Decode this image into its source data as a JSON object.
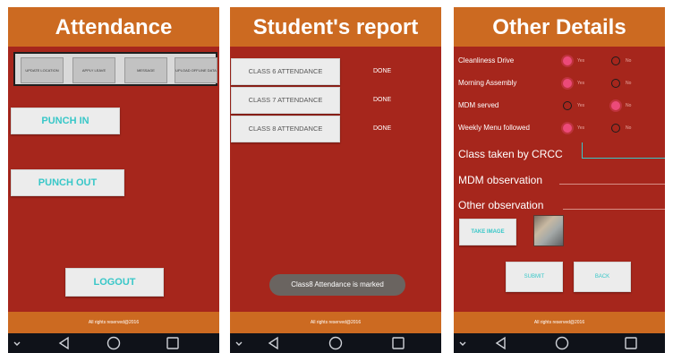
{
  "attendance": {
    "title": "Attendance",
    "toolbar": [
      "UPDATE LOCATION",
      "APPLY LEAVE",
      "MESSAGE",
      "UPLOAD OFFLINE DATA"
    ],
    "punch_in": "PUNCH IN",
    "punch_out": "PUNCH OUT",
    "logout": "LOGOUT",
    "footer": "All rights reserved@2016"
  },
  "report": {
    "title": "Student's report",
    "rows": [
      {
        "label": "CLASS 6 ATTENDANCE",
        "status": "DONE"
      },
      {
        "label": "CLASS 7 ATTENDANCE",
        "status": "DONE"
      },
      {
        "label": "CLASS 8 ATTENDANCE",
        "status": "DONE"
      }
    ],
    "toast": "Class8 Attendance is marked",
    "footer": "All rights reserved@2016"
  },
  "details": {
    "title": "Other Details",
    "questions": [
      {
        "label": "Cleanliness Drive",
        "selected": "Yes"
      },
      {
        "label": "Morning Assembly",
        "selected": "Yes"
      },
      {
        "label": "MDM served",
        "selected": "No"
      },
      {
        "label": "Weekly Menu followed",
        "selected": "Yes"
      }
    ],
    "yes": "Yes",
    "no": "No",
    "class_taken": "Class taken by CRCC",
    "mdm_observation": "MDM observation",
    "other_observation": "Other observation",
    "take_image": "TAKE IMAGE",
    "submit": "SUBMIT",
    "back": "BACK",
    "footer": "All rights reserved@2016"
  },
  "colors": {
    "brand": "#cc6a21",
    "body": "#a6261c",
    "accent": "#38c7c8",
    "radio_on": "#ec4a79",
    "navbar": "#0f1219"
  },
  "icons": [
    "chevron-down-icon",
    "back-triangle-icon",
    "home-circle-icon",
    "recents-square-icon",
    "thumbnail-image"
  ]
}
